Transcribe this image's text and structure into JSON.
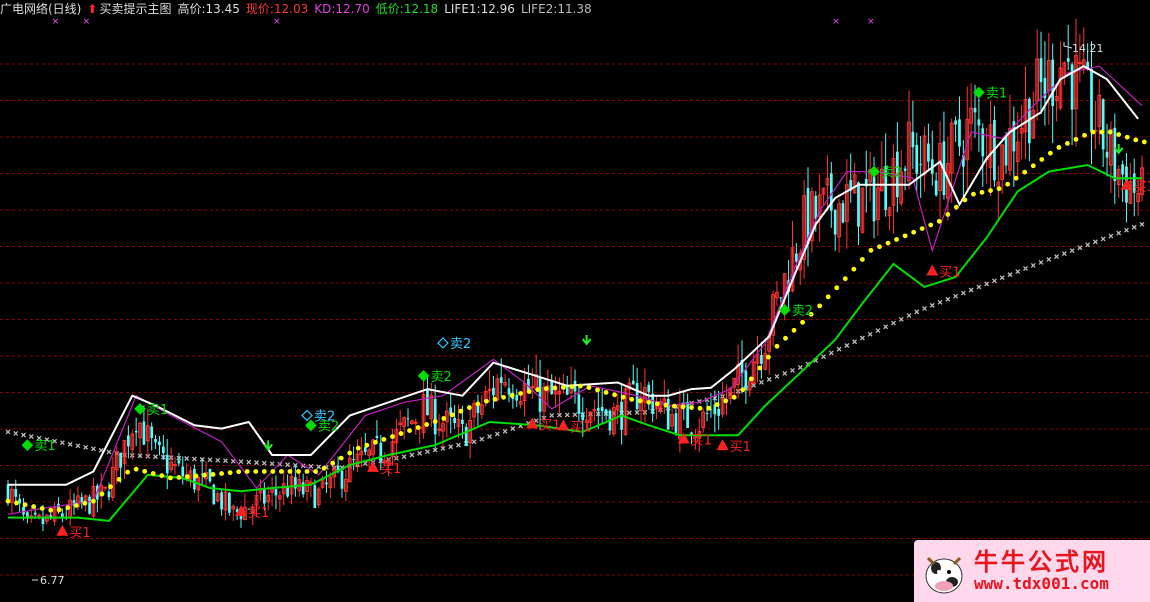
{
  "header": {
    "title": "广电网络(日线)",
    "indicator": "买卖提示主图",
    "high": "高价:13.45",
    "price": "现价:12.03",
    "kd": "KD:12.70",
    "low": "低价:12.18",
    "life1": "LIFE1:12.96",
    "life2": "LIFE2:11.38"
  },
  "colors": {
    "background": "#000000",
    "up": "#ff3333",
    "down": "#54fcfc",
    "price_line": "#ffffff",
    "kd_line": "#c020c0",
    "dots": "#ffff00",
    "support": "#00dd00",
    "long_ma": "#bbbbbb",
    "sell_marker": "#00dd00",
    "buy_marker": "#ff2020",
    "grid": "#8b0000"
  },
  "chart_data": {
    "type": "candlestick",
    "y_range": [
      5.8,
      14.6
    ],
    "max_label": "14.21",
    "min_label": "6.77",
    "candles_anchor": [
      [
        0,
        7.5
      ],
      [
        5,
        6.9
      ],
      [
        10,
        7.0
      ],
      [
        18,
        7.2
      ],
      [
        25,
        7.4
      ],
      [
        33,
        8.6
      ],
      [
        38,
        8.0
      ],
      [
        45,
        7.7
      ],
      [
        52,
        7.5
      ],
      [
        58,
        7.1
      ],
      [
        65,
        7.3
      ],
      [
        72,
        7.5
      ],
      [
        80,
        7.4
      ],
      [
        88,
        7.8
      ],
      [
        97,
        8.1
      ],
      [
        107,
        8.7
      ],
      [
        117,
        8.3
      ],
      [
        127,
        9.2
      ],
      [
        137,
        8.9
      ],
      [
        148,
        8.8
      ],
      [
        157,
        8.6
      ],
      [
        163,
        9.0
      ],
      [
        170,
        8.6
      ],
      [
        178,
        8.5
      ],
      [
        186,
        8.9
      ],
      [
        195,
        9.8
      ],
      [
        205,
        11.5
      ],
      [
        212,
        11.8
      ],
      [
        222,
        11.9
      ],
      [
        232,
        12.6
      ],
      [
        240,
        12.3
      ],
      [
        248,
        13.0
      ],
      [
        256,
        12.6
      ],
      [
        264,
        13.4
      ],
      [
        272,
        14.0
      ],
      [
        279,
        13.2
      ],
      [
        285,
        12.4
      ],
      [
        292,
        11.9
      ]
    ],
    "candle_count": 293,
    "price_line": [
      [
        0,
        7.55
      ],
      [
        15,
        7.55
      ],
      [
        22,
        7.75
      ],
      [
        32,
        8.9
      ],
      [
        38,
        8.75
      ],
      [
        48,
        8.45
      ],
      [
        55,
        8.4
      ],
      [
        62,
        8.5
      ],
      [
        68,
        8.0
      ],
      [
        78,
        8.0
      ],
      [
        88,
        8.6
      ],
      [
        98,
        8.8
      ],
      [
        108,
        9.0
      ],
      [
        117,
        8.9
      ],
      [
        125,
        9.4
      ],
      [
        136,
        9.2
      ],
      [
        144,
        9.05
      ],
      [
        157,
        9.1
      ],
      [
        165,
        8.9
      ],
      [
        170,
        8.9
      ],
      [
        176,
        9.0
      ],
      [
        181,
        9.02
      ],
      [
        187,
        9.3
      ],
      [
        196,
        9.8
      ],
      [
        203,
        10.8
      ],
      [
        208,
        11.5
      ],
      [
        213,
        11.9
      ],
      [
        219,
        12.1
      ],
      [
        232,
        12.1
      ],
      [
        240,
        12.45
      ],
      [
        245,
        11.8
      ],
      [
        252,
        12.5
      ],
      [
        258,
        12.9
      ],
      [
        266,
        13.2
      ],
      [
        271,
        13.7
      ],
      [
        277,
        13.9
      ],
      [
        283,
        13.7
      ],
      [
        291,
        13.1
      ]
    ],
    "kd_line": [
      [
        0,
        7.1
      ],
      [
        10,
        7.2
      ],
      [
        22,
        7.3
      ],
      [
        33,
        8.9
      ],
      [
        42,
        8.6
      ],
      [
        55,
        8.2
      ],
      [
        64,
        7.5
      ],
      [
        72,
        8.0
      ],
      [
        80,
        7.7
      ],
      [
        92,
        8.6
      ],
      [
        102,
        8.8
      ],
      [
        112,
        8.9
      ],
      [
        125,
        9.45
      ],
      [
        133,
        9.1
      ],
      [
        140,
        8.7
      ],
      [
        150,
        9.05
      ],
      [
        162,
        8.9
      ],
      [
        170,
        8.75
      ],
      [
        178,
        8.8
      ],
      [
        186,
        9.0
      ],
      [
        195,
        9.7
      ],
      [
        203,
        10.9
      ],
      [
        209,
        11.7
      ],
      [
        216,
        12.3
      ],
      [
        224,
        12.3
      ],
      [
        233,
        12.2
      ],
      [
        238,
        11.1
      ],
      [
        248,
        12.9
      ],
      [
        256,
        12.8
      ],
      [
        264,
        13.3
      ],
      [
        273,
        13.8
      ],
      [
        281,
        13.9
      ],
      [
        292,
        13.3
      ]
    ],
    "dots_line": [
      [
        0,
        7.3
      ],
      [
        12,
        7.15
      ],
      [
        22,
        7.3
      ],
      [
        32,
        7.8
      ],
      [
        42,
        7.65
      ],
      [
        52,
        7.7
      ],
      [
        60,
        7.75
      ],
      [
        70,
        7.75
      ],
      [
        80,
        7.75
      ],
      [
        90,
        8.1
      ],
      [
        100,
        8.3
      ],
      [
        112,
        8.55
      ],
      [
        122,
        8.8
      ],
      [
        137,
        9.0
      ],
      [
        148,
        9.05
      ],
      [
        160,
        8.85
      ],
      [
        170,
        8.75
      ],
      [
        180,
        8.7
      ],
      [
        188,
        8.9
      ],
      [
        198,
        9.65
      ],
      [
        208,
        10.2
      ],
      [
        216,
        10.7
      ],
      [
        222,
        11.1
      ],
      [
        230,
        11.3
      ],
      [
        240,
        11.55
      ],
      [
        248,
        11.95
      ],
      [
        256,
        12.05
      ],
      [
        262,
        12.3
      ],
      [
        270,
        12.65
      ],
      [
        279,
        12.9
      ],
      [
        284,
        12.9
      ],
      [
        292,
        12.75
      ]
    ],
    "support_line": [
      [
        0,
        7.05
      ],
      [
        18,
        7.05
      ],
      [
        26,
        7.0
      ],
      [
        36,
        7.7
      ],
      [
        45,
        7.65
      ],
      [
        52,
        7.5
      ],
      [
        60,
        7.45
      ],
      [
        68,
        7.5
      ],
      [
        78,
        7.55
      ],
      [
        88,
        7.85
      ],
      [
        98,
        8.0
      ],
      [
        110,
        8.15
      ],
      [
        124,
        8.5
      ],
      [
        136,
        8.45
      ],
      [
        148,
        8.35
      ],
      [
        158,
        8.6
      ],
      [
        165,
        8.45
      ],
      [
        173,
        8.3
      ],
      [
        188,
        8.3
      ],
      [
        195,
        8.75
      ],
      [
        205,
        9.3
      ],
      [
        213,
        9.75
      ],
      [
        220,
        10.3
      ],
      [
        228,
        10.9
      ],
      [
        236,
        10.55
      ],
      [
        244,
        10.7
      ],
      [
        252,
        11.3
      ],
      [
        260,
        12.0
      ],
      [
        268,
        12.3
      ],
      [
        278,
        12.4
      ],
      [
        285,
        12.2
      ],
      [
        292,
        12.2
      ]
    ],
    "long_ma": [
      [
        0,
        8.35
      ],
      [
        30,
        8.0
      ],
      [
        60,
        7.9
      ],
      [
        85,
        7.8
      ],
      [
        100,
        7.95
      ],
      [
        120,
        8.2
      ],
      [
        140,
        8.6
      ],
      [
        165,
        8.65
      ],
      [
        185,
        8.9
      ],
      [
        205,
        9.35
      ],
      [
        235,
        10.2
      ],
      [
        265,
        10.9
      ],
      [
        292,
        11.5
      ]
    ],
    "sell_markers": [
      {
        "x": 5,
        "y": 8.15,
        "label": "卖1",
        "style": "solid"
      },
      {
        "x": 34,
        "y": 8.7,
        "label": "卖1",
        "style": "solid"
      },
      {
        "x": 77,
        "y": 8.6,
        "label": "卖2",
        "style": "outline"
      },
      {
        "x": 78,
        "y": 8.45,
        "label": "卖2",
        "style": "solid"
      },
      {
        "x": 107,
        "y": 9.2,
        "label": "卖2",
        "style": "solid"
      },
      {
        "x": 112,
        "y": 9.7,
        "label": "卖2",
        "style": "outline"
      },
      {
        "x": 200,
        "y": 10.2,
        "label": "卖2",
        "style": "solid"
      },
      {
        "x": 223,
        "y": 12.3,
        "label": "卖2",
        "style": "solid"
      },
      {
        "x": 250,
        "y": 13.5,
        "label": "卖1",
        "style": "solid"
      }
    ],
    "buy_markers": [
      {
        "x": 14,
        "y": 6.85,
        "label": "买1"
      },
      {
        "x": 60,
        "y": 7.15,
        "label": "买1"
      },
      {
        "x": 94,
        "y": 7.82,
        "label": "买1"
      },
      {
        "x": 135,
        "y": 8.48,
        "label": "买1"
      },
      {
        "x": 143,
        "y": 8.45,
        "label": "买1"
      },
      {
        "x": 174,
        "y": 8.25,
        "label": "买1"
      },
      {
        "x": 184,
        "y": 8.15,
        "label": "买1"
      },
      {
        "x": 238,
        "y": 10.8,
        "label": "买1"
      },
      {
        "x": 288,
        "y": 12.1,
        "label": "买1"
      }
    ],
    "down_arrows": [
      [
        67,
        8.1
      ],
      [
        149,
        9.7
      ],
      [
        286,
        12.6
      ]
    ],
    "top_marks": [
      12,
      20,
      69,
      213,
      222
    ]
  },
  "watermark": {
    "cn": "牛牛公式网",
    "url": "www.tdx001.com"
  }
}
